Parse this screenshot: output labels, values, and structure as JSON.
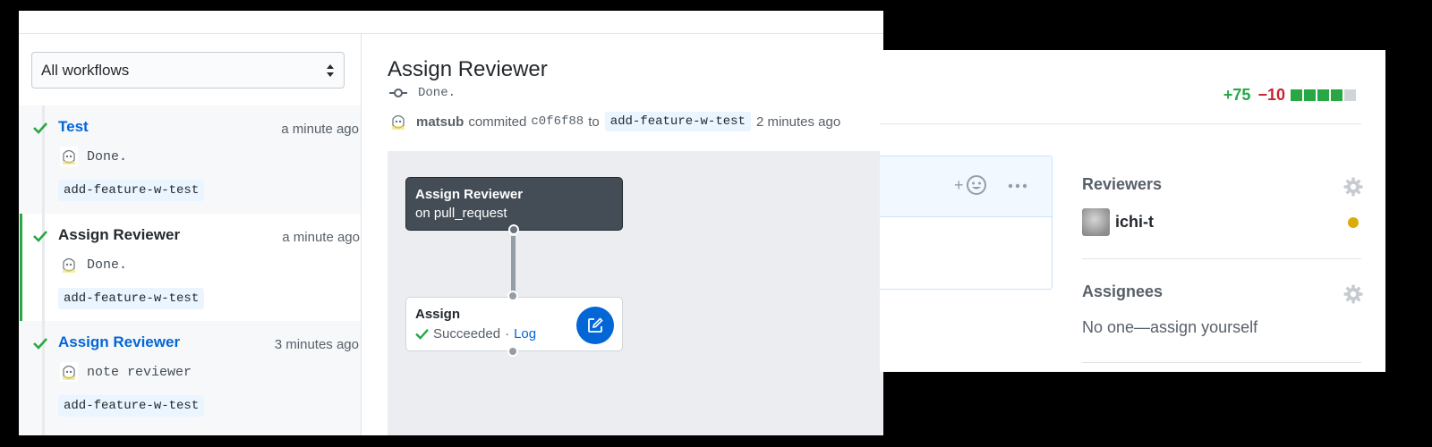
{
  "sidebar": {
    "filter_value": "All workflows",
    "runs": [
      {
        "title": "Test",
        "time": "a minute ago",
        "message": "Done.",
        "branch": "add-feature-w-test",
        "active": false
      },
      {
        "title": "Assign Reviewer",
        "time": "a minute ago",
        "message": "Done.",
        "branch": "add-feature-w-test",
        "active": true
      },
      {
        "title": "Assign Reviewer",
        "time": "3 minutes ago",
        "message": "note reviewer",
        "branch": "add-feature-w-test",
        "active": false
      }
    ]
  },
  "detail": {
    "title": "Assign Reviewer",
    "status_message": "Done.",
    "commit": {
      "user": "matsub",
      "verb": "commited",
      "sha": "c0f6f88",
      "to": "to",
      "branch": "add-feature-w-test",
      "time": "2 minutes ago"
    },
    "graph": {
      "trigger_title": "Assign Reviewer",
      "trigger_event": "on pull_request",
      "job_title": "Assign",
      "job_status": "Succeeded",
      "job_separator": "·",
      "job_log": "Log"
    }
  },
  "pr_sidebar": {
    "additions": "+75",
    "deletions": "−10",
    "diff_blocks": [
      "add",
      "add",
      "add",
      "add",
      "neutral"
    ],
    "reviewers_label": "Reviewers",
    "reviewer_name": "ichi-t",
    "assignees_label": "Assignees",
    "assignees_empty": "No one—assign yourself"
  },
  "colors": {
    "success": "#28a745",
    "danger": "#cb2431",
    "link": "#0366d6",
    "pending": "#dbab09",
    "neutral_block": "#d1d5da"
  },
  "icons": {
    "run_status": "check-icon",
    "commit": "git-commit-icon",
    "edit": "pencil-icon",
    "reaction": "smiley-icon",
    "menu": "kebab-horizontal-icon",
    "settings": "gear-icon"
  }
}
